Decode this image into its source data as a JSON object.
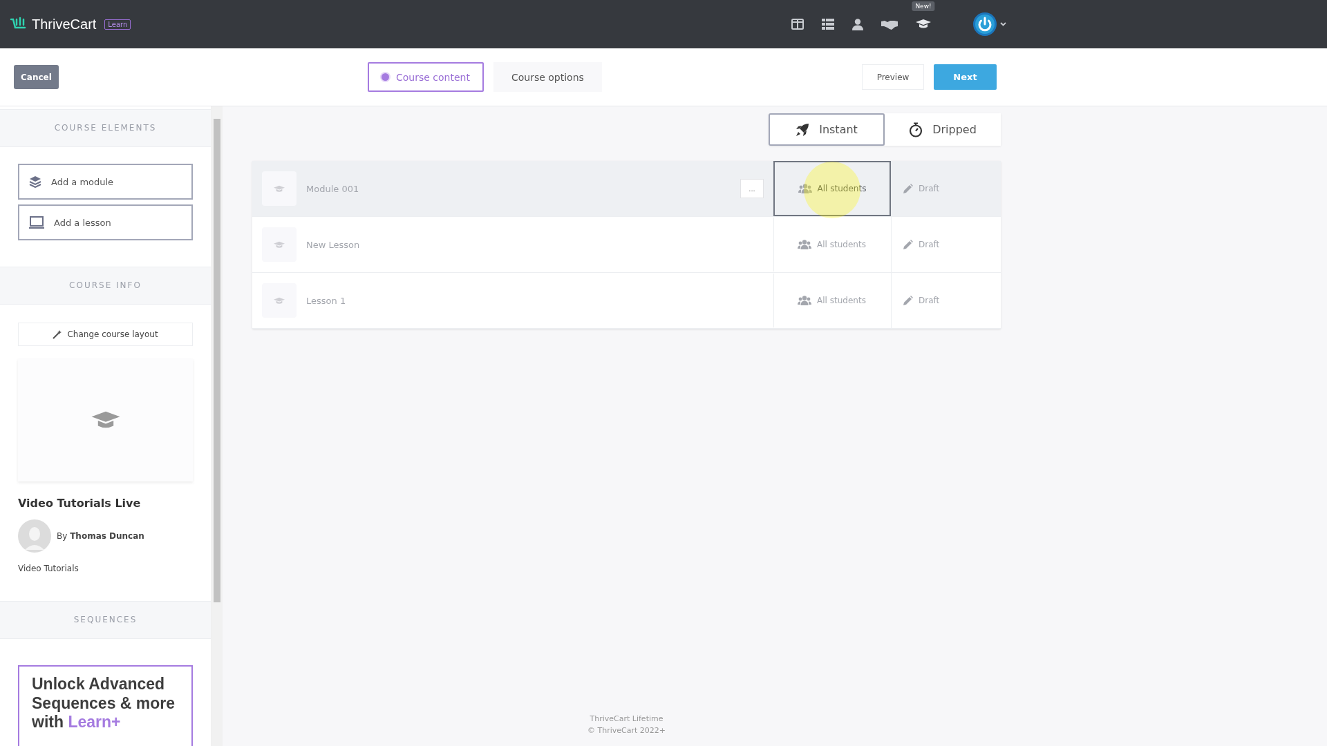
{
  "topbar": {
    "brand": "ThriveCart",
    "product_badge": "Learn",
    "nav_icons": [
      {
        "kind": "columns"
      },
      {
        "kind": "grid"
      },
      {
        "kind": "user"
      },
      {
        "kind": "handshake"
      },
      {
        "kind": "cap",
        "badge": "New!"
      }
    ]
  },
  "toolbar": {
    "cancel": "Cancel",
    "tabs": [
      {
        "label": "Course content",
        "selected": true
      },
      {
        "label": "Course options",
        "selected": false
      }
    ],
    "preview": "Preview",
    "next": "Next"
  },
  "sidebar": {
    "elements_title": "COURSE ELEMENTS",
    "add_buttons": [
      {
        "kind": "module",
        "label": "Add a module"
      },
      {
        "kind": "lesson",
        "label": "Add a lesson"
      }
    ],
    "info_title": "COURSE INFO",
    "layout_button": "Change course layout",
    "course_title": "Video Tutorials Live",
    "author": "By **Thomas Duncan**",
    "category": "Video Tutorials",
    "sequences_title": "SEQUENCES",
    "promo": {
      "text": "Unlock Advanced Sequences & more with",
      "highlight": "Learn+"
    }
  },
  "release": [
    {
      "kind": "instant",
      "label": "Instant",
      "selected": true
    },
    {
      "kind": "dripped",
      "label": "Dripped",
      "selected": false
    }
  ],
  "rows": [
    {
      "title": "Module 001",
      "menu": "...",
      "highlighted": true,
      "audience": "All students",
      "audience_focused": true,
      "status": "Draft"
    },
    {
      "title": "New Lesson",
      "highlighted": false,
      "audience": "All students",
      "audience_focused": false,
      "status": "Draft"
    },
    {
      "title": "Lesson 1",
      "highlighted": false,
      "audience": "All students",
      "audience_focused": false,
      "status": "Draft"
    }
  ],
  "footer": [
    "ThriveCart Lifetime",
    "© ThriveCart 2022+"
  ]
}
